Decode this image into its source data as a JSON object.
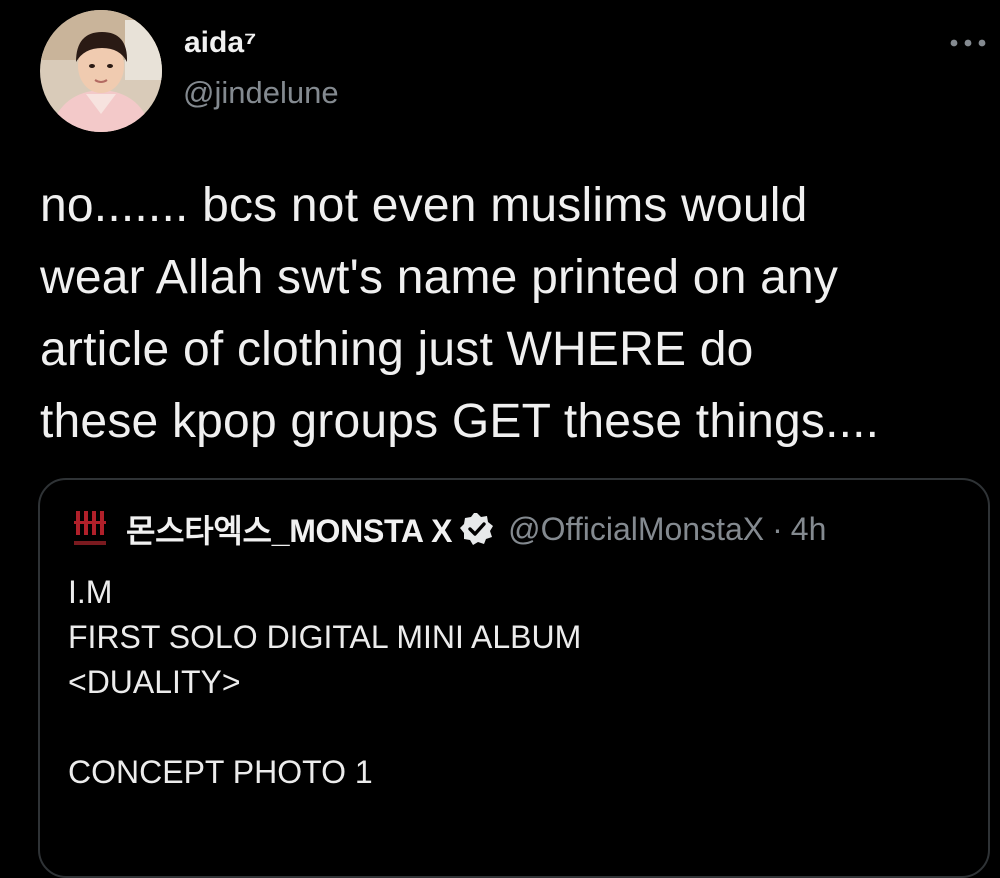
{
  "tweet": {
    "display_name": "aida⁷",
    "handle": "@jindelune",
    "more_icon": "more-horizontal-icon",
    "text_lines": [
      "no....... bcs not even muslims would",
      "wear Allah swt's name printed on any",
      "article of clothing just WHERE do",
      "these kpop groups GET these things...."
    ]
  },
  "quoted_tweet": {
    "display_name": "몬스타엑스_MONSTA X",
    "verified_icon": "verified-badge-icon",
    "handle": "@OfficialMonstaX",
    "separator": "·",
    "time": "4h",
    "text_lines": [
      "I.M",
      "FIRST SOLO DIGITAL MINI ALBUM",
      "<DUALITY>",
      "",
      "CONCEPT PHOTO 1"
    ]
  },
  "colors": {
    "background": "#000000",
    "primary_text": "#e7e9ea",
    "secondary_text": "#848a90",
    "card_border": "#2f3336",
    "monsta_logo_red": "#b0202a"
  }
}
